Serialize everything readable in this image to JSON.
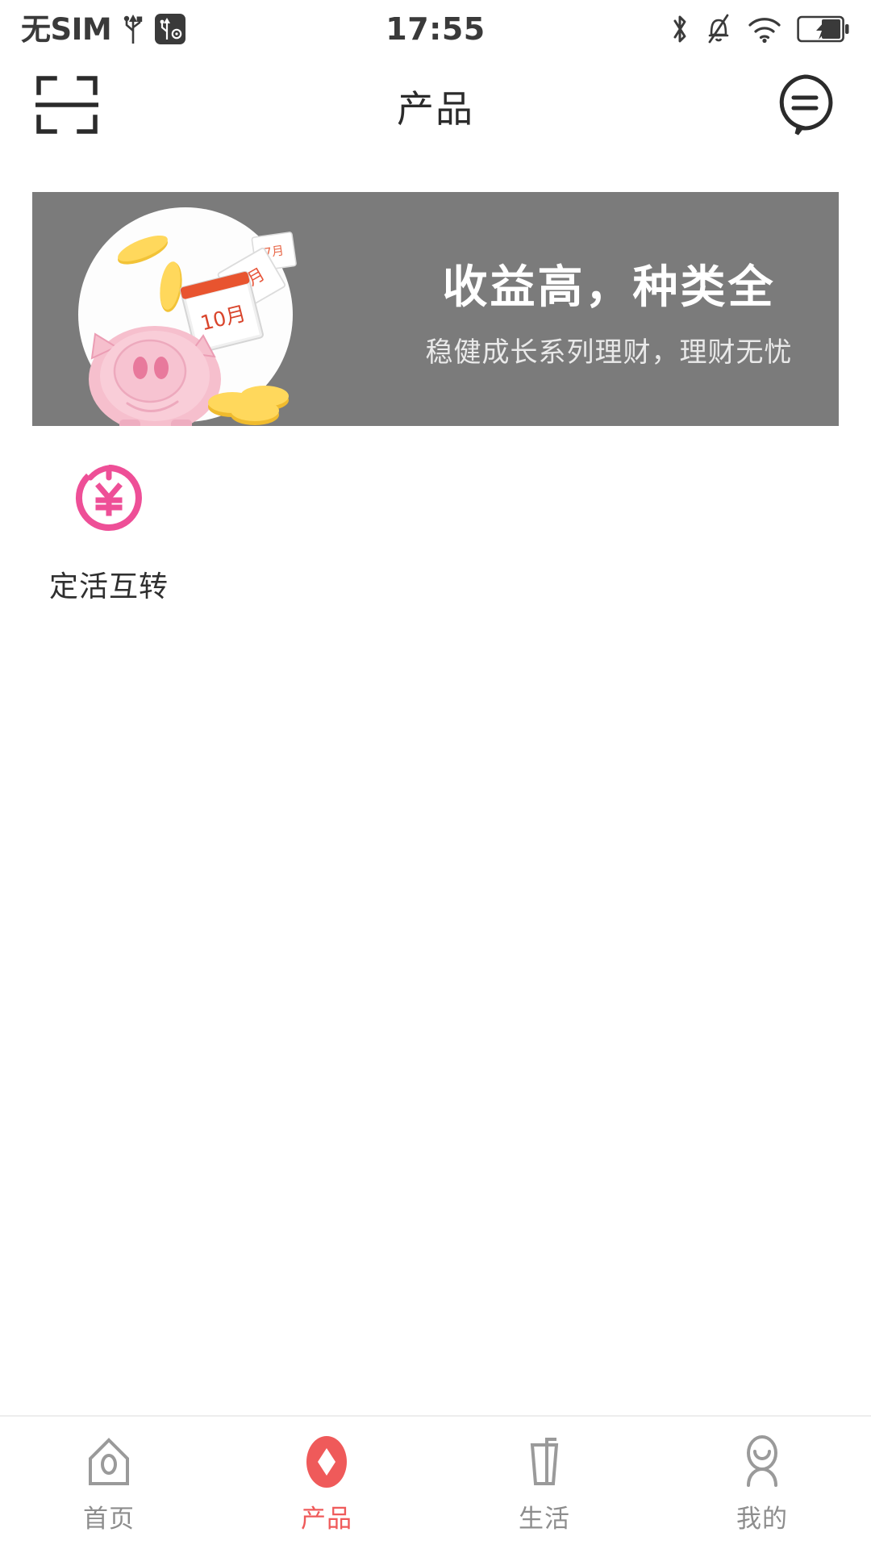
{
  "status_bar": {
    "carrier": "无SIM",
    "time": "17:55",
    "left_icons": [
      "usb-icon",
      "usb-debug-icon"
    ],
    "right_icons": [
      "bluetooth-icon",
      "mute-bell-icon",
      "wifi-icon",
      "battery-charging-icon"
    ]
  },
  "header": {
    "title": "产品",
    "left_icon": "scan-qr-icon",
    "right_icon": "message-bubble-icon"
  },
  "banner": {
    "title": "收益高，种类全",
    "subtitle": "稳健成长系列理财，理财无忧",
    "bg_color": "#7b7b7b",
    "calendar_labels": [
      "10月",
      "9月",
      "7月"
    ],
    "art": "piggy-bank-illustration"
  },
  "features": [
    {
      "label": "定活互转",
      "icon": "yuan-transfer-circle-icon",
      "color": "#ee4f97"
    }
  ],
  "tabbar": {
    "accent_color": "#ef5a5a",
    "inactive_color": "#8d8d8d",
    "items": [
      {
        "label": "首页",
        "icon": "home-icon",
        "active": false
      },
      {
        "label": "产品",
        "icon": "product-diamond-icon",
        "active": true
      },
      {
        "label": "生活",
        "icon": "cup-straw-icon",
        "active": false
      },
      {
        "label": "我的",
        "icon": "person-icon",
        "active": false
      }
    ]
  }
}
